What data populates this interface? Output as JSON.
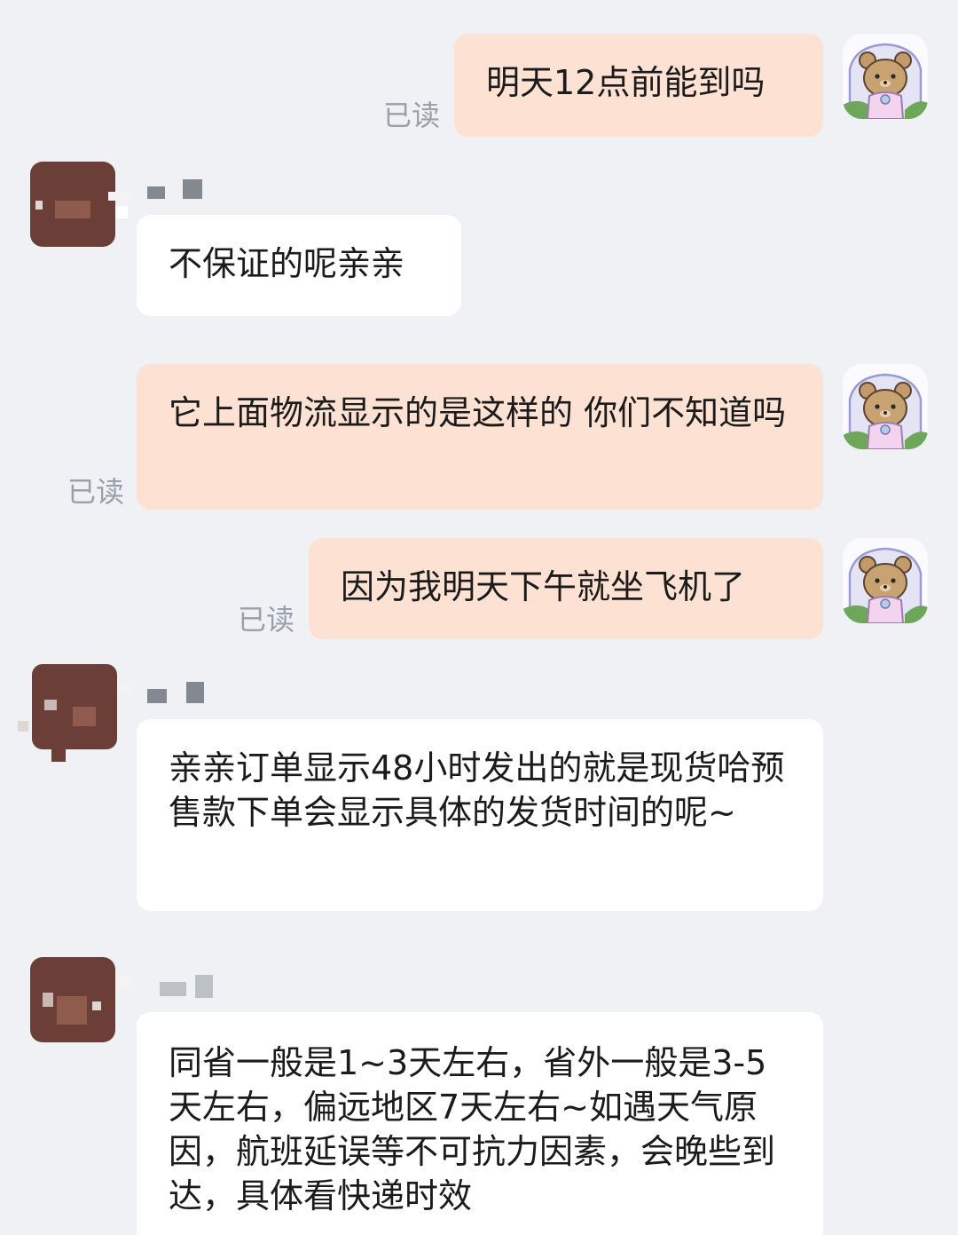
{
  "messages": [
    {
      "sender": "self",
      "text": "明天12点前能到吗",
      "status": "已读"
    },
    {
      "sender": "other",
      "text": "不保证的呢亲亲"
    },
    {
      "sender": "self",
      "text": "它上面物流显示的是这样的 你们不知道吗",
      "status": "已读"
    },
    {
      "sender": "self",
      "text": "因为我明天下午就坐飞机了",
      "status": "已读"
    },
    {
      "sender": "other",
      "text": "亲亲订单显示48小时发出的就是现货哈预售款下单会显示具体的发货时间的呢~"
    },
    {
      "sender": "other",
      "text": "同省一般是1~3天左右，省外一般是3-5天左右，偏远地区7天左右~如遇天气原因，航班延误等不可抗力因素，会晚些到达，具体看快递时效"
    }
  ],
  "icons": {
    "self_avatar": "bear-avatar-icon",
    "other_avatar": "pixelated-avatar-icon"
  },
  "colors": {
    "background": "#eff1f4",
    "self_bubble": "#fde1d2",
    "other_bubble": "#ffffff",
    "read_status": "#9aa0a8"
  }
}
